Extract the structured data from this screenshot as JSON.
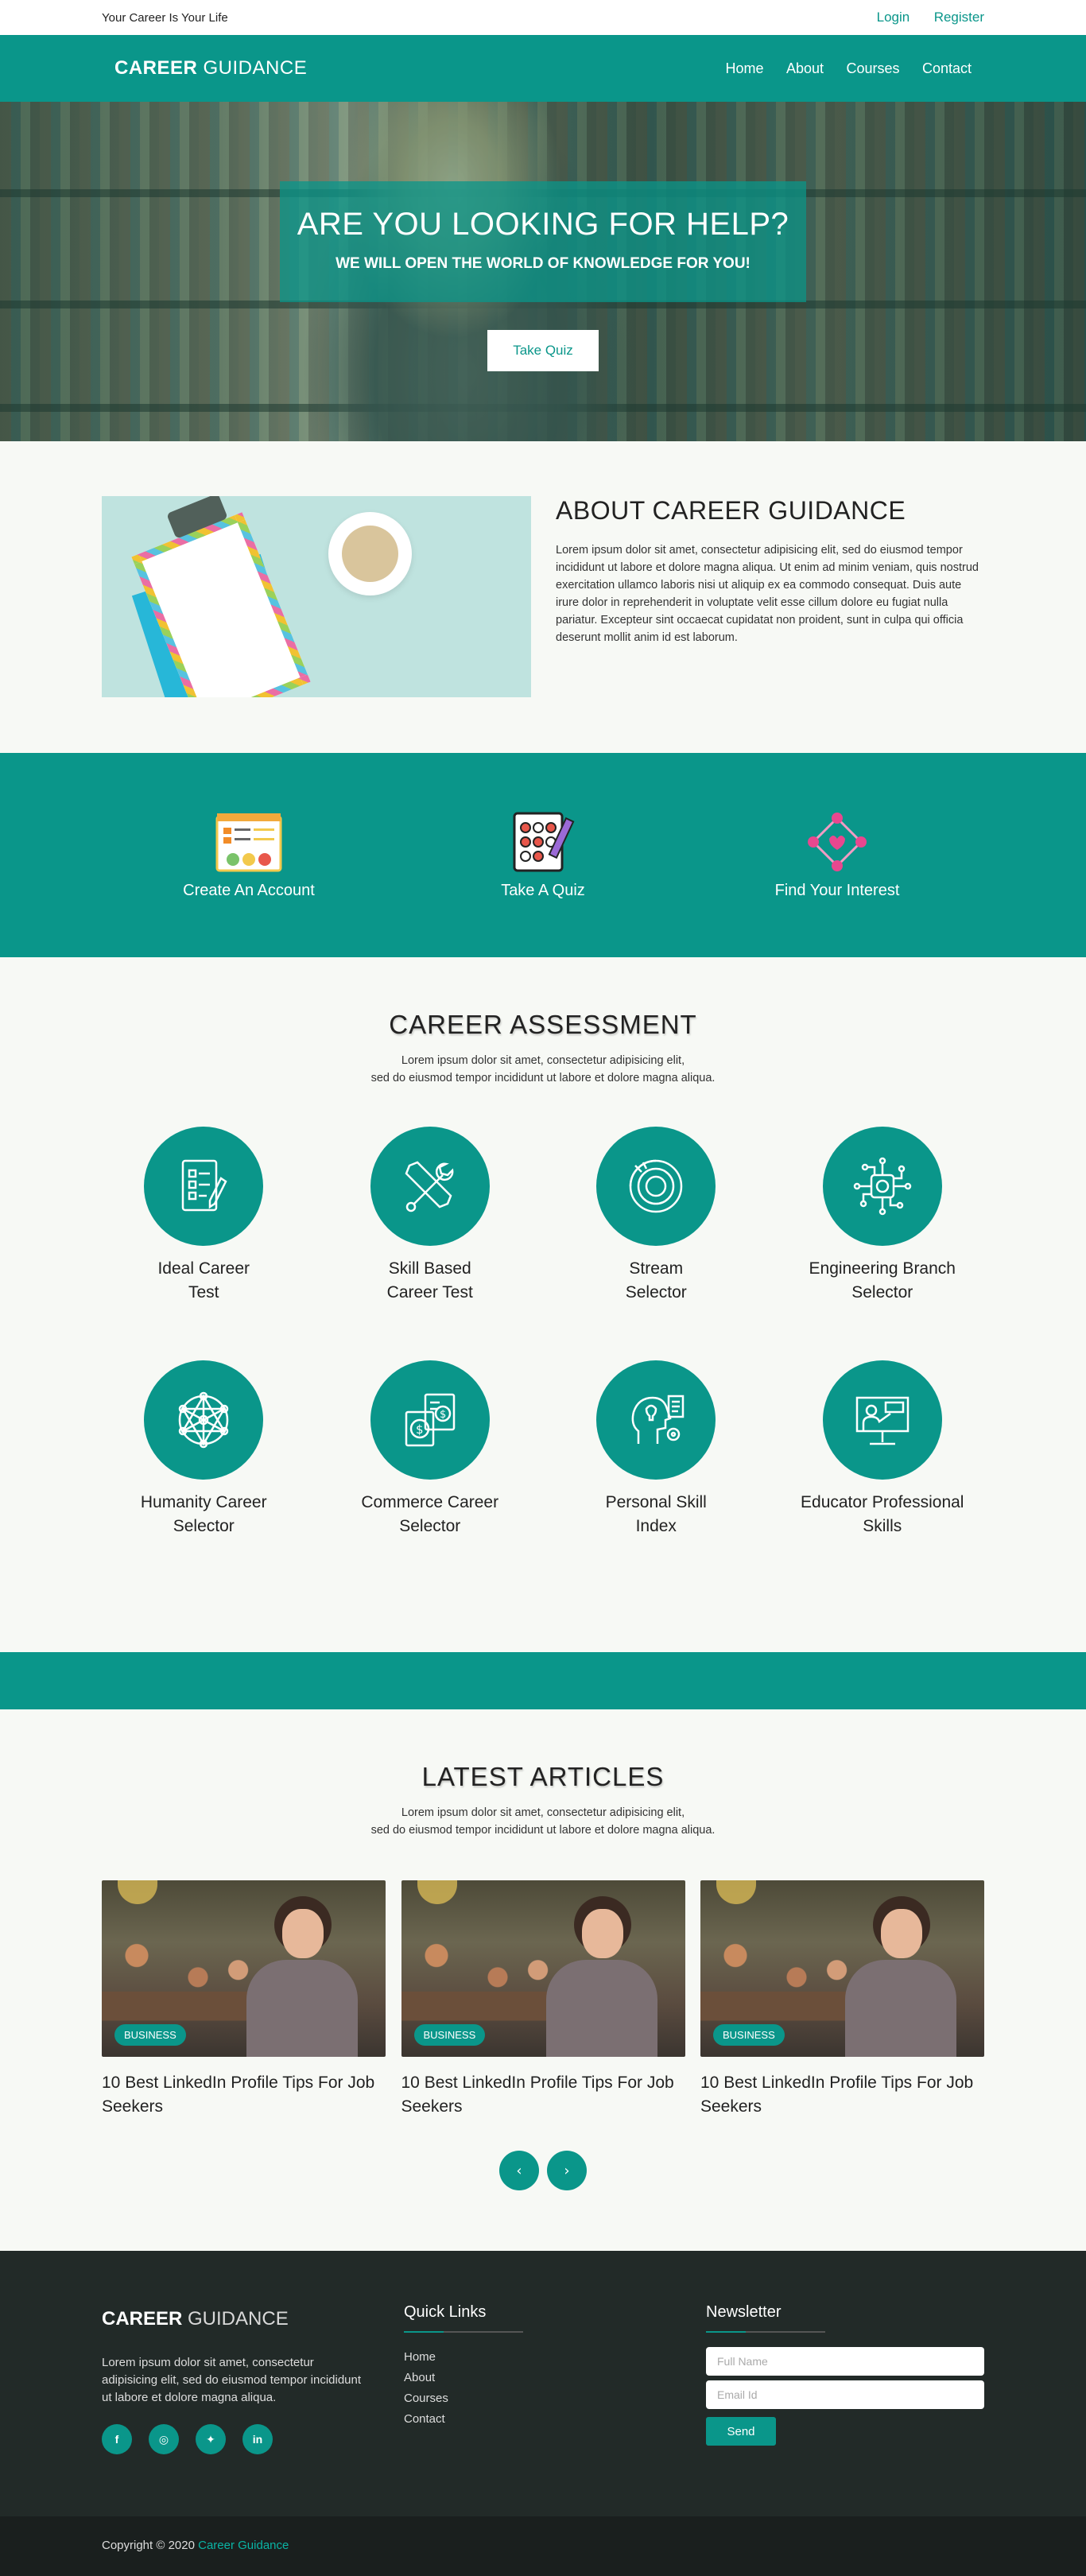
{
  "topbar": {
    "tagline": "Your Career Is Your Life",
    "login": "Login",
    "register": "Register"
  },
  "nav": {
    "logo_bold": "CAREER",
    "logo_light": "GUIDANCE",
    "links": [
      "Home",
      "About",
      "Courses",
      "Contact"
    ]
  },
  "hero": {
    "title": "ARE YOU LOOKING FOR HELP?",
    "subtitle": "WE WILL OPEN THE WORLD OF KNOWLEDGE FOR YOU!",
    "button": "Take Quiz"
  },
  "about": {
    "title": "ABOUT CAREER GUIDANCE",
    "text": "Lorem ipsum dolor sit amet, consectetur adipisicing elit, sed do eiusmod tempor incididunt ut labore et dolore magna aliqua. Ut enim ad minim veniam, quis nostrud exercitation ullamco laboris nisi ut aliquip ex ea commodo consequat. Duis aute irure dolor in reprehenderit in voluptate velit esse cillum dolore eu fugiat nulla pariatur. Excepteur sint occaecat cupidatat non proident, sunt in culpa qui officia deserunt mollit anim id est laborum."
  },
  "steps": [
    {
      "label": "Create An Account",
      "icon": "emoji-checklist-icon"
    },
    {
      "label": "Take A Quiz",
      "icon": "quiz-sheet-icon"
    },
    {
      "label": "Find Your Interest",
      "icon": "interest-network-icon"
    }
  ],
  "assessment": {
    "title": "CAREER ASSESSMENT",
    "sub_line1": "Lorem ipsum dolor sit amet, consectetur adipisicing elit,",
    "sub_line2": "sed do eiusmod tempor incididunt ut labore et dolore magna aliqua.",
    "tools": [
      {
        "line1": "Ideal Career",
        "line2": "Test",
        "icon": "checklist-pencil-icon"
      },
      {
        "line1": "Skill Based",
        "line2": "Career Test",
        "icon": "tools-icon"
      },
      {
        "line1": "Stream",
        "line2": "Selector",
        "icon": "radar-icon"
      },
      {
        "line1": "Engineering Branch",
        "line2": "Selector",
        "icon": "circuit-brain-icon"
      },
      {
        "line1": "Humanity Career",
        "line2": "Selector",
        "icon": "network-icon"
      },
      {
        "line1": "Commerce Career",
        "line2": "Selector",
        "icon": "money-document-icon"
      },
      {
        "line1": "Personal Skill",
        "line2": "Index",
        "icon": "head-idea-icon"
      },
      {
        "line1": "Educator Professional",
        "line2": "Skills",
        "icon": "teacher-board-icon"
      }
    ]
  },
  "articles": {
    "title": "LATEST ARTICLES",
    "sub_line1": "Lorem ipsum dolor sit amet, consectetur adipisicing elit,",
    "sub_line2": "sed do eiusmod tempor incididunt ut labore et dolore magna aliqua.",
    "items": [
      {
        "badge": "BUSINESS",
        "title": "10 Best LinkedIn Profile Tips For Job Seekers"
      },
      {
        "badge": "BUSINESS",
        "title": "10 Best LinkedIn Profile Tips For Job Seekers"
      },
      {
        "badge": "BUSINESS",
        "title": "10 Best LinkedIn Profile Tips For Job Seekers"
      }
    ],
    "prev": "‹",
    "next": "›"
  },
  "footer": {
    "logo_bold": "CAREER",
    "logo_light": "GUIDANCE",
    "description": "Lorem ipsum dolor sit amet, consectetur adipisicing elit, sed do eiusmod tempor incididunt ut labore et dolore magna aliqua.",
    "social": [
      {
        "glyph": "f",
        "icon": "facebook-icon"
      },
      {
        "glyph": "◎",
        "icon": "instagram-icon"
      },
      {
        "glyph": "✦",
        "icon": "twitter-icon"
      },
      {
        "glyph": "in",
        "icon": "linkedin-icon"
      }
    ],
    "quick_links_title": "Quick Links",
    "quick_links": [
      "Home",
      "About",
      "Courses",
      "Contact"
    ],
    "newsletter_title": "Newsletter",
    "name_placeholder": "Full Name",
    "email_placeholder": "Email Id",
    "send": "Send"
  },
  "copyright": {
    "text": "Copyright © 2020",
    "brand": "Career Guidance"
  },
  "colors": {
    "accent": "#0a968a",
    "footer_bg": "#222a28",
    "copyright_bg": "#1a1f1e",
    "page_bg": "#f7f9f5"
  }
}
